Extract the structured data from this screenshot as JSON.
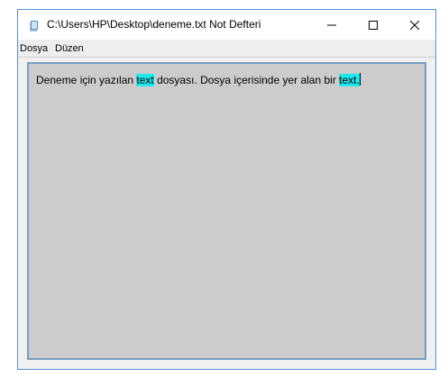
{
  "window": {
    "title": "C:\\Users\\HP\\Desktop\\deneme.txt Not Defteri"
  },
  "controls": {
    "minimize_glyph": "—",
    "maximize_glyph": "☐",
    "close_glyph": "✕"
  },
  "menu": {
    "items": [
      {
        "label": "Dosya"
      },
      {
        "label": "Düzen"
      }
    ]
  },
  "editor": {
    "segments": [
      {
        "text": "Deneme için yazılan ",
        "highlight": false
      },
      {
        "text": "text",
        "highlight": true
      },
      {
        "text": " dosyası. Dosya içerisinde yer alan bir ",
        "highlight": false
      },
      {
        "text": "text.",
        "highlight": true
      }
    ],
    "highlight_color": "#1fe8ec",
    "background_color": "#cccccc"
  },
  "icons": {
    "app_icon": "notepad-icon"
  }
}
